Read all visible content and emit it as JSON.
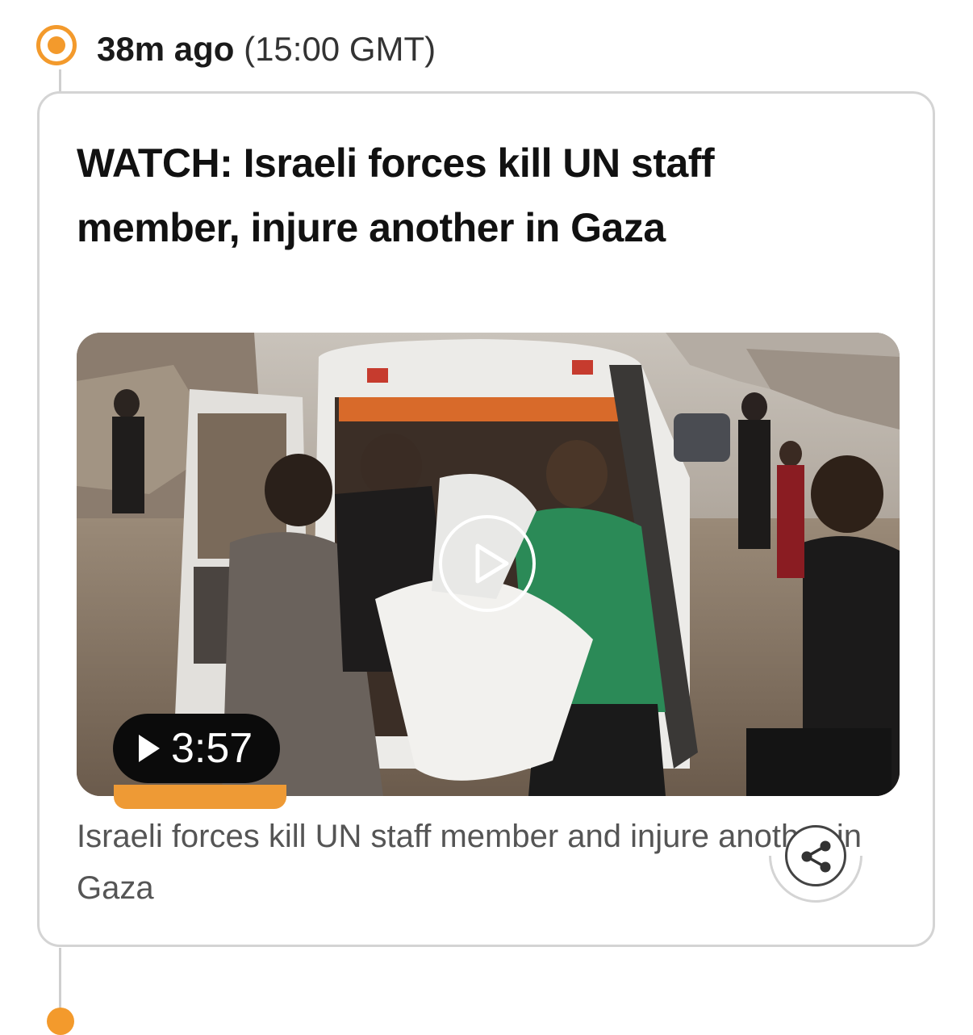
{
  "entry": {
    "relative_time": "38m ago",
    "absolute_time": "(15:00 GMT)",
    "headline": "WATCH: Israeli forces kill UN staff member, injure another in Gaza",
    "video": {
      "duration": "3:57",
      "thumbnail": "ambulance-scene-image",
      "progress": 0.0
    },
    "caption": "Israeli forces kill UN staff member and injure another in Gaza",
    "share_icon": "share-icon"
  },
  "colors": {
    "accent": "#f39a2c",
    "card_border": "#d4d4d4",
    "headline": "#111111",
    "caption": "#555555"
  }
}
